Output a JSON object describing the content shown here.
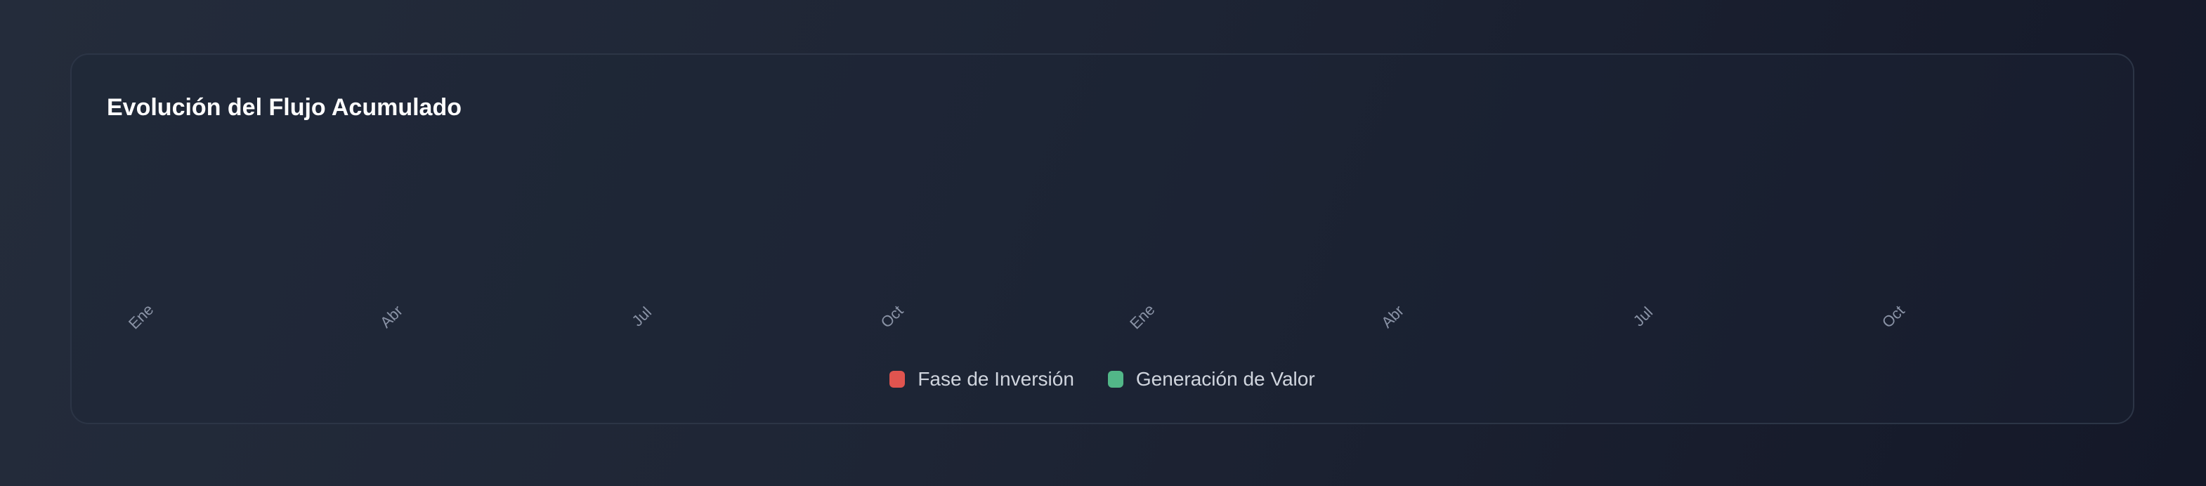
{
  "chart_data": {
    "type": "line",
    "title": "Evolución del Flujo Acumulado",
    "x_tick_labels": [
      "Ene",
      "Abr",
      "Jul",
      "Oct",
      "Ene",
      "Abr",
      "Jul",
      "Oct"
    ],
    "series": [
      {
        "name": "Fase de Inversión",
        "color": "#e0544f",
        "values": []
      },
      {
        "name": "Generación de Valor",
        "color": "#52b788",
        "values": []
      }
    ],
    "legend_placement": "bottom",
    "grid": false
  }
}
